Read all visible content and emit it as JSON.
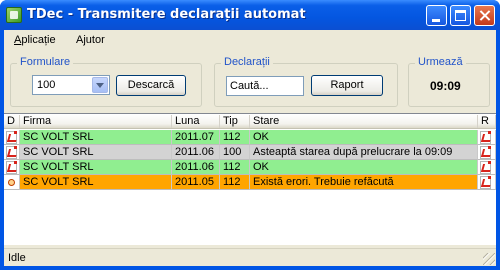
{
  "window": {
    "title": "TDec - Transmitere declarații automat"
  },
  "menu": [
    {
      "label": "Aplicație",
      "mnemonic_index": 0
    },
    {
      "label": "Ajutor",
      "mnemonic_index": 1
    }
  ],
  "formulare": {
    "group_label": "Formulare",
    "selected": "100",
    "download_button": "Descarcă"
  },
  "declaratii": {
    "group_label": "Declarații",
    "search_value": "Caută...",
    "report_button": "Raport"
  },
  "urmeaza": {
    "group_label": "Urmează",
    "time": "09:09"
  },
  "table": {
    "columns": [
      "D",
      "Firma",
      "Luna",
      "Tip",
      "Stare",
      "R"
    ],
    "rows": [
      {
        "firma": "SC VOLT SRL",
        "luna": "2011.07",
        "tip": "112",
        "stare": "OK",
        "status": "ok",
        "d_icon": "pdf-icon",
        "r_icon": "pdf-icon"
      },
      {
        "firma": "SC VOLT SRL",
        "luna": "2011.06",
        "tip": "100",
        "stare": "Asteaptă starea după prelucrare la 09:09",
        "status": "pending",
        "d_icon": "pdf-icon",
        "r_icon": "pdf-icon"
      },
      {
        "firma": "SC VOLT SRL",
        "luna": "2011.06",
        "tip": "112",
        "stare": "OK",
        "status": "ok",
        "d_icon": "pdf-icon",
        "r_icon": "pdf-icon"
      },
      {
        "firma": "SC VOLT SRL",
        "luna": "2011.05",
        "tip": "112",
        "stare": "Există erori. Trebuie refăcută",
        "status": "error",
        "d_icon": "warning-icon",
        "r_icon": "pdf-icon"
      }
    ],
    "status_colors": {
      "ok": "#90ee90",
      "pending": "#d3d3d3",
      "error": "#ffa500"
    }
  },
  "statusbar": {
    "text": "Idle"
  }
}
